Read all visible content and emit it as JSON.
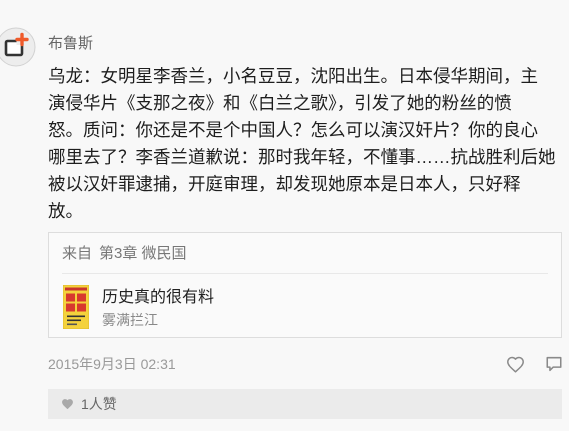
{
  "comment": {
    "author": "布鲁斯",
    "avatar_icon": "app-logo-icon",
    "body_lines": [
      "乌龙：女明星李香兰，小名豆豆，沈阳出生。日本侵华期间，主",
      "演侵华片《支那之夜》和《白兰之歌》，引发了她的粉丝的愤",
      "怒。质问：你还是不是个中国人？怎么可以演汉奸片？你的良心",
      "哪里去了？李香兰道歉说：那时我年轻，不懂事……抗战胜利后她",
      "被以汉奸罪逮捕，开庭审理，却发现她原本是日本人，只好释",
      "放。"
    ],
    "timestamp": "2015年9月3日 02:31"
  },
  "source": {
    "from_label": "来自",
    "chapter": "第3章 微民国",
    "book": {
      "title": "历史真的很有料",
      "author": "雾满拦江"
    }
  },
  "actions": {
    "like_icon": "heart-outline-icon",
    "comment_icon": "comment-icon"
  },
  "likes": {
    "icon": "heart-filled-icon",
    "label": "1人赞"
  },
  "colors": {
    "background": "#f8f8f8",
    "text_primary": "#1e1e1e",
    "text_secondary": "#777777",
    "text_muted": "#999999",
    "border": "#dddddd",
    "likes_bar": "#ebebeb",
    "avatar_accent": "#ef5a2a",
    "cover_yellow": "#f4d23c",
    "cover_red": "#d8392e"
  }
}
